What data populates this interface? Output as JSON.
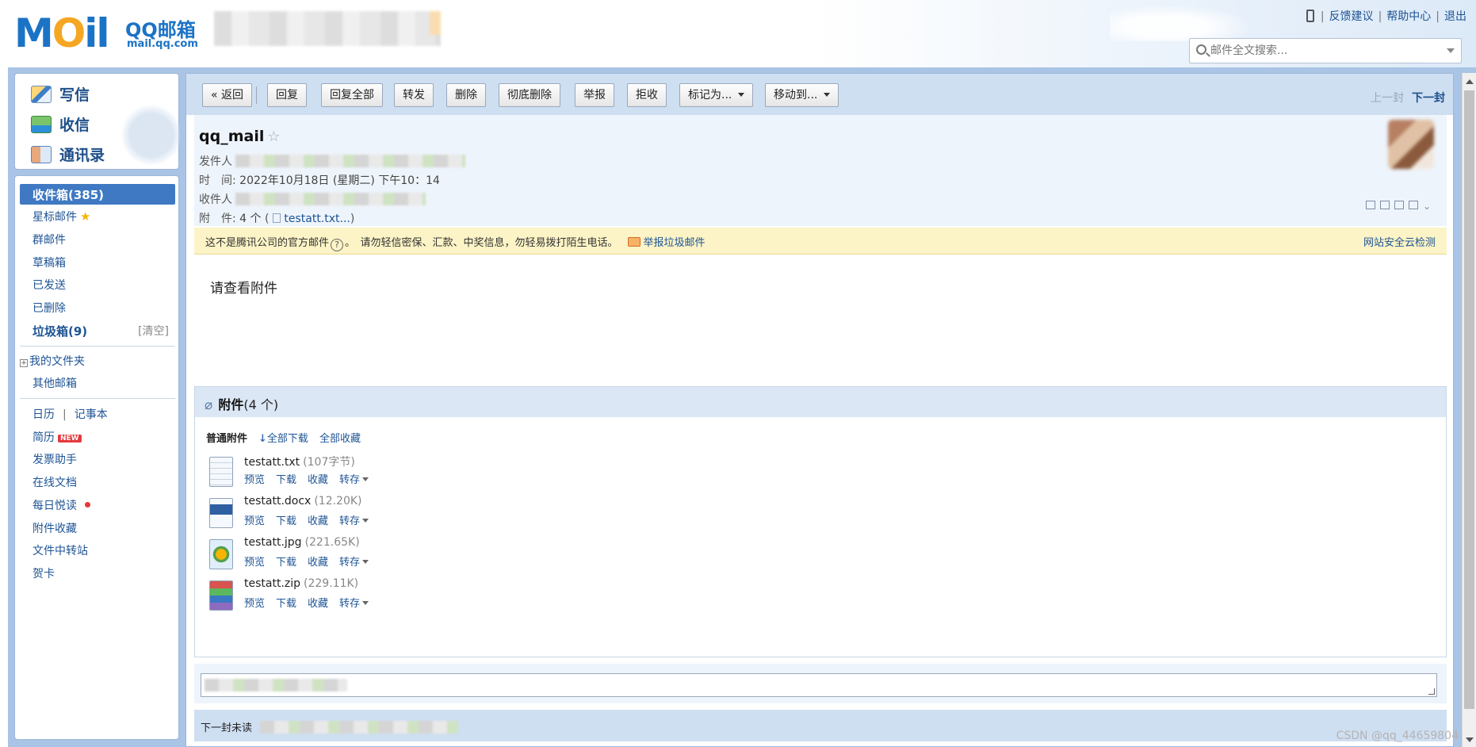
{
  "header": {
    "logo_word": "MOil",
    "brand_cn": "QQ邮箱",
    "brand_url": "mail.qq.com",
    "links": [
      "反馈建议",
      "帮助中心",
      "退出"
    ],
    "search_placeholder": "邮件全文搜索..."
  },
  "quick": {
    "write": "写信",
    "inbox": "收信",
    "contacts": "通讯录"
  },
  "nav": {
    "inbox": "收件箱(385)",
    "starred": "星标邮件",
    "group": "群邮件",
    "drafts": "草稿箱",
    "sent": "已发送",
    "deleted": "已删除",
    "spam": "垃圾箱(9)",
    "spam_clear": "[清空]",
    "my_folders": "我的文件夹",
    "other_mailbox": "其他邮箱",
    "calendar": "日历",
    "notepad": "记事本",
    "resume": "简历",
    "new_badge": "NEW",
    "invoice": "发票助手",
    "online_docs": "在线文档",
    "daily_read": "每日悦读",
    "attach_fav": "附件收藏",
    "file_transfer": "文件中转站",
    "cards": "贺卡"
  },
  "toolbar": {
    "back": "« 返回",
    "reply": "回复",
    "reply_all": "回复全部",
    "forward": "转发",
    "delete": "删除",
    "perm_delete": "彻底删除",
    "report": "举报",
    "reject": "拒收",
    "mark_as": "标记为...",
    "move_to": "移动到...",
    "prev": "上一封",
    "next": "下一封"
  },
  "mail": {
    "subject": "qq_mail",
    "from_label": "发件人",
    "time_label": "时　间:",
    "time_value": "2022年10月18日 (星期二) 下午10：14",
    "to_label": "收件人",
    "attach_label": "附　件:",
    "attach_summary": "4 个",
    "attach_first": "testatt.txt...",
    "body": "请查看附件"
  },
  "warning": {
    "official_text": "这不是腾讯公司的官方邮件",
    "q_mark": "?",
    "caution_text": "。　请勿轻信密保、汇款、中奖信息，勿轻易拨打陌生电话。",
    "report_link": "举报垃圾邮件",
    "safety_link": "网站安全云检测"
  },
  "attachments": {
    "title": "附件",
    "count": "(4 个)",
    "normal_label": "普通附件",
    "download_all": "全部下载",
    "save_all": "全部收藏",
    "actions": {
      "preview": "预览",
      "download": "下载",
      "collect": "收藏",
      "transfer": "转存"
    },
    "files": [
      {
        "name": "testatt.txt",
        "size": "(107字节)",
        "type": "txt"
      },
      {
        "name": "testatt.docx",
        "size": "(12.20K)",
        "type": "docx"
      },
      {
        "name": "testatt.jpg",
        "size": "(221.65K)",
        "type": "jpg"
      },
      {
        "name": "testatt.zip",
        "size": "(229.11K)",
        "type": "zip"
      }
    ]
  },
  "footer": {
    "next_unread": "下一封未读",
    "watermark": "CSDN @qq_44659804"
  }
}
